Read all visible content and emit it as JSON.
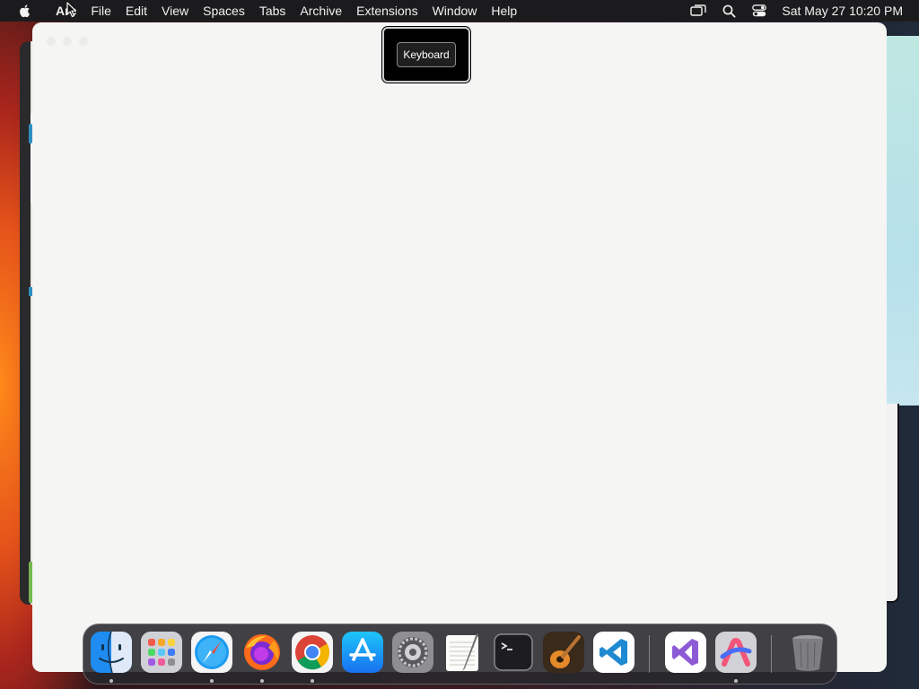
{
  "menubar": {
    "app_name": "Arc",
    "items": [
      "File",
      "Edit",
      "View",
      "Spaces",
      "Tabs",
      "Archive",
      "Extensions",
      "Window",
      "Help"
    ],
    "clock": "Sat May 27  10:20 PM",
    "tray_icons": [
      "screen-mirroring-icon",
      "search-icon",
      "control-center-icon"
    ]
  },
  "hud": {
    "label": "Keyboard"
  },
  "dock": {
    "apps": [
      {
        "name": "Finder",
        "icon": "finder-icon",
        "running": true
      },
      {
        "name": "Launchpad",
        "icon": "launchpad-icon",
        "running": false
      },
      {
        "name": "Safari",
        "icon": "safari-icon",
        "running": true
      },
      {
        "name": "Firefox",
        "icon": "firefox-icon",
        "running": true
      },
      {
        "name": "Google Chrome",
        "icon": "chrome-icon",
        "running": true
      },
      {
        "name": "App Store",
        "icon": "app-store-icon",
        "running": false
      },
      {
        "name": "System Settings",
        "icon": "system-settings-icon",
        "running": false
      },
      {
        "name": "TextEdit",
        "icon": "textedit-icon",
        "running": false
      },
      {
        "name": "Terminal",
        "icon": "terminal-icon",
        "running": false
      },
      {
        "name": "GarageBand",
        "icon": "garageband-icon",
        "running": false
      },
      {
        "name": "Visual Studio Code",
        "icon": "vscode-icon",
        "running": false
      },
      {
        "name": "Visual Studio",
        "icon": "visual-studio-icon",
        "running": false
      },
      {
        "name": "Arc",
        "icon": "arc-icon",
        "running": true
      },
      {
        "name": "Trash",
        "icon": "trash-icon",
        "running": false
      }
    ]
  },
  "colors": {
    "menubar_bg": "#1b1b1d",
    "window_bg": "#f5f5f4",
    "hud_bg": "#000000"
  }
}
